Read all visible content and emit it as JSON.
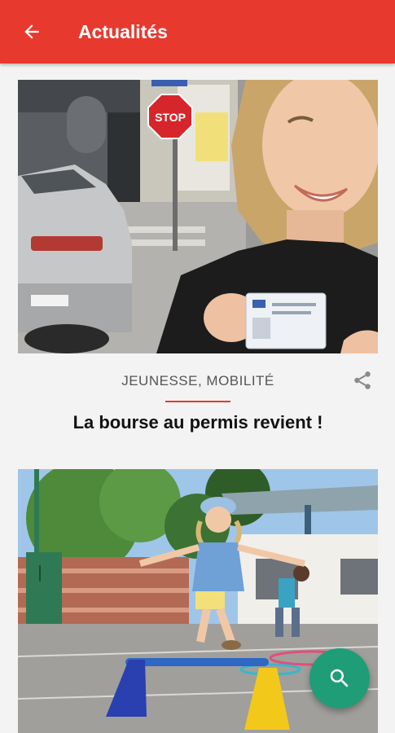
{
  "appbar": {
    "title": "Actualités"
  },
  "articles": [
    {
      "category": "JEUNESSE, MOBILITÉ",
      "headline": "La bourse au permis revient !"
    },
    {
      "category": "",
      "headline": ""
    }
  ],
  "photo1": {
    "sign": "STOP"
  },
  "colors": {
    "accent": "#e8392f",
    "fab": "#1f9d77"
  },
  "icons": {
    "back": "arrow-back-icon",
    "share": "share-icon",
    "search": "search-icon"
  }
}
